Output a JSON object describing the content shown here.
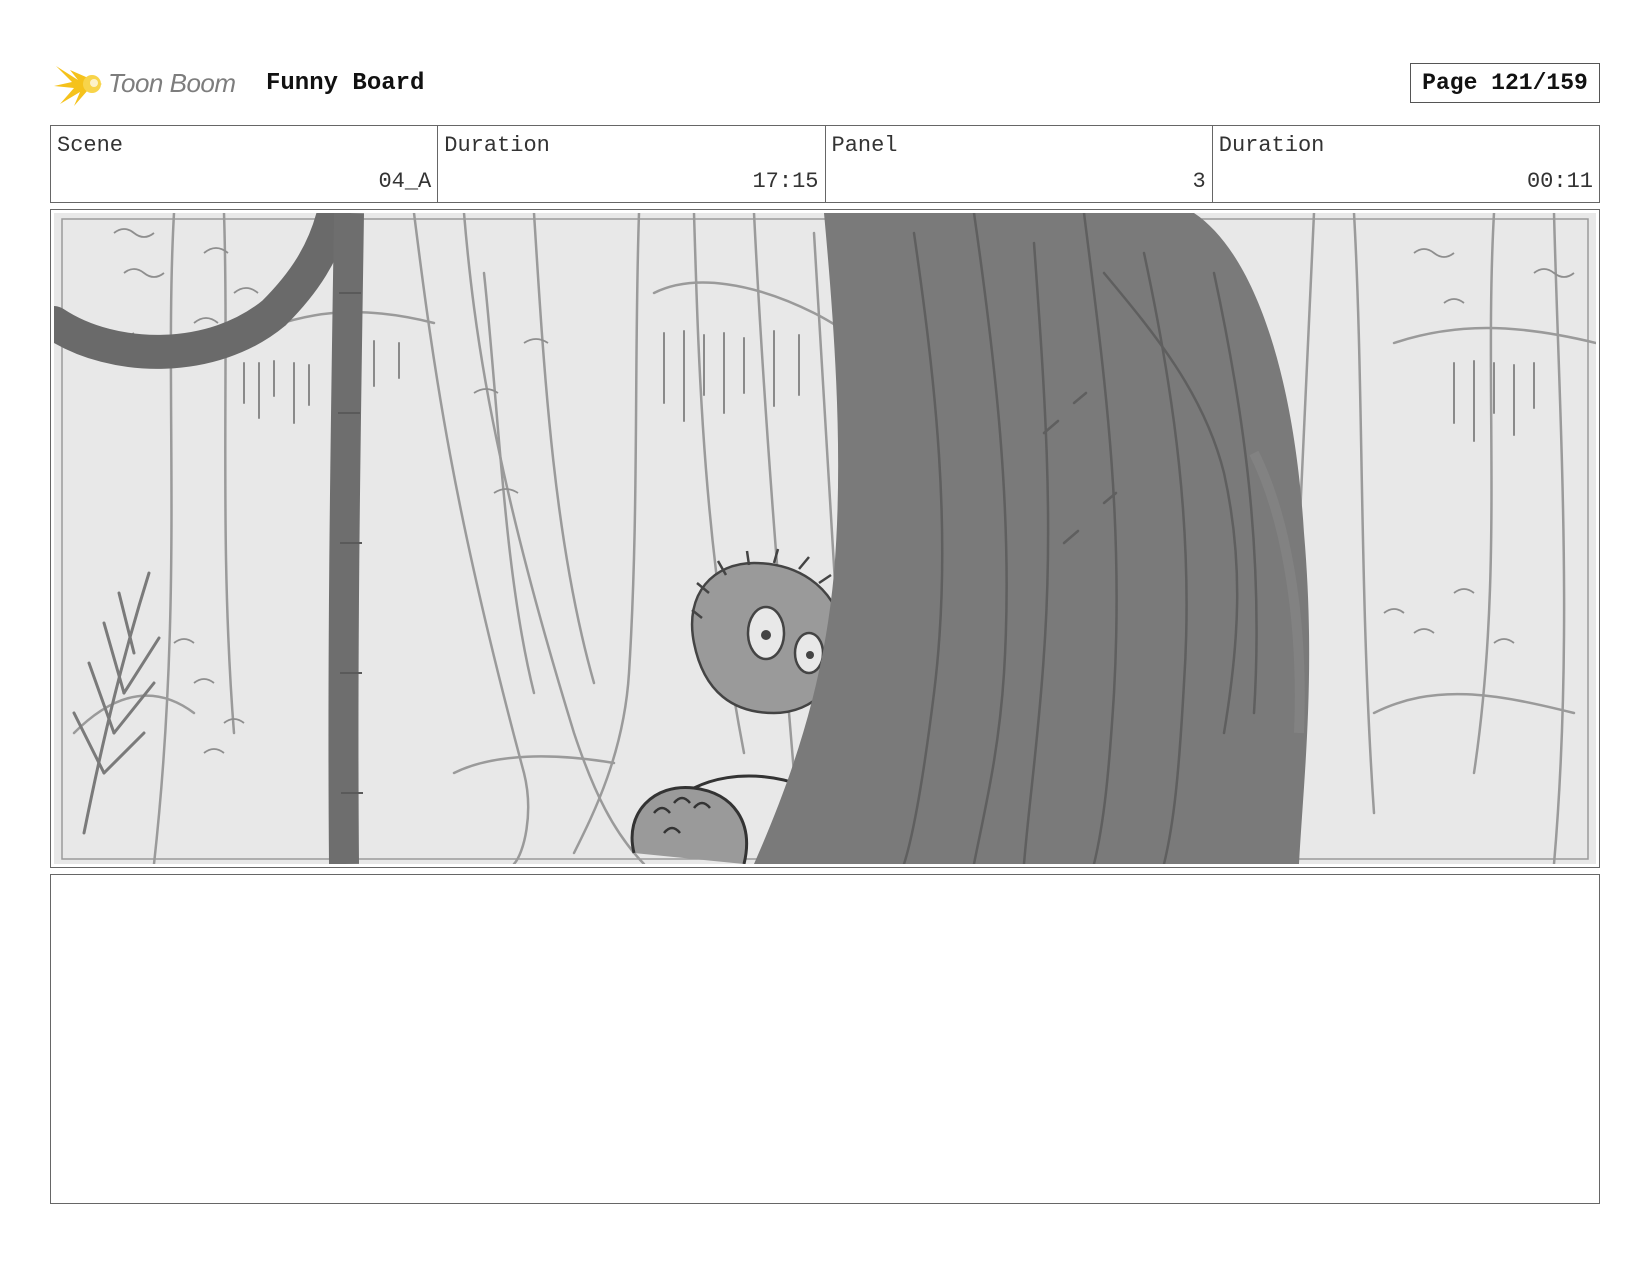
{
  "header": {
    "logo_text": "Toon Boom",
    "board_title": "Funny Board",
    "page_label": "Page 121/159"
  },
  "info": [
    {
      "label": "Scene",
      "value": "04_A"
    },
    {
      "label": "Duration",
      "value": "17:15"
    },
    {
      "label": "Panel",
      "value": "3"
    },
    {
      "label": "Duration",
      "value": "00:11"
    }
  ],
  "colors": {
    "logo_star": "#f5c21b",
    "logo_text": "#7d7d7d",
    "sketch_bg": "#e6e6e6",
    "sketch_line": "#8a8a8a",
    "tree_fill": "#7a7a7a"
  }
}
